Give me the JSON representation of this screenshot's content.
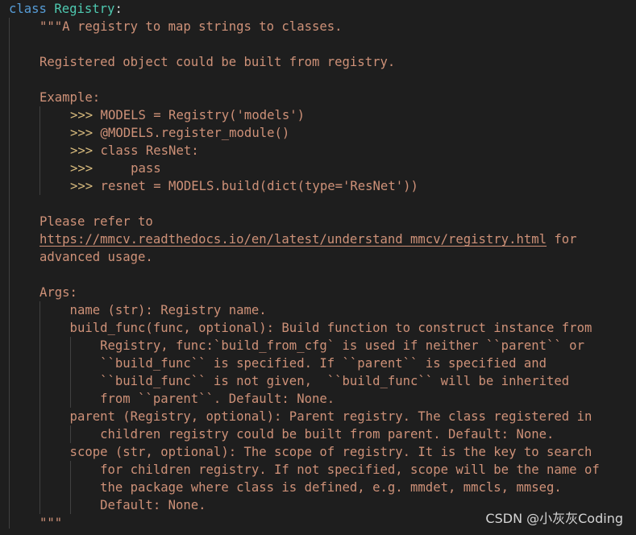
{
  "code": {
    "class_keyword": "class",
    "class_name": "Registry",
    "class_colon": ":",
    "lines": [
      "\"\"\"A registry to map strings to classes.",
      "",
      "Registered object could be built from registry.",
      "",
      "Example:",
      "",
      "",
      "",
      "",
      "",
      "",
      "Please refer to",
      "",
      "advanced usage.",
      "",
      "Args:",
      "    name (str): Registry name.",
      "    build_func(func, optional): Build function to construct instance from",
      "        Registry, func:`build_from_cfg` is used if neither ``parent`` or",
      "        ``build_func`` is specified. If ``parent`` is specified and",
      "        ``build_func`` is not given,  ``build_func`` will be inherited",
      "        from ``parent``. Default: None.",
      "    parent (Registry, optional): Parent registry. The class registered in",
      "        children registry could be built from parent. Default: None.",
      "    scope (str, optional): The scope of registry. It is the key to search",
      "        for children registry. If not specified, scope will be the name of",
      "        the package where class is defined, e.g. mmdet, mmcls, mmseg.",
      "        Default: None.",
      "\"\"\""
    ],
    "examples": [
      {
        "prompt": ">>>",
        "code": " MODELS = Registry('models')"
      },
      {
        "prompt": ">>>",
        "code": " @MODELS.register_module()"
      },
      {
        "prompt": ">>>",
        "code": " class ResNet:"
      },
      {
        "prompt": ">>>",
        "code": "     pass"
      },
      {
        "prompt": ">>>",
        "code": " resnet = MODELS.build(dict(type='ResNet'))"
      }
    ],
    "url": "https://mmcv.readthedocs.io/en/latest/understand_mmcv/registry.html",
    "url_suffix": " for"
  },
  "watermark": "CSDN @小灰灰Coding",
  "colors": {
    "background": "#1e1e1e",
    "string": "#ce9178",
    "keyword": "#569cd6",
    "class_name": "#4ec9b0",
    "prompt": "#d7ba7d"
  }
}
